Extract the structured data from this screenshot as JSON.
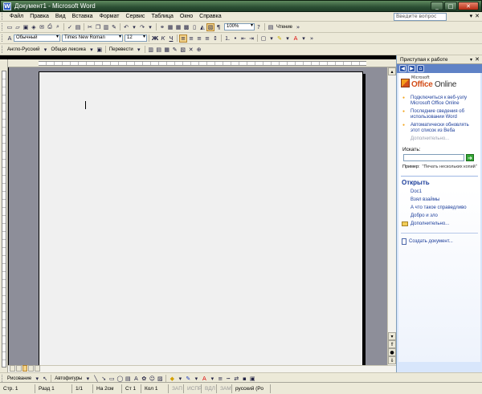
{
  "window": {
    "title": "Документ1 - Microsoft Word",
    "app_icon_letter": "W",
    "controls": {
      "minimize": "_",
      "maximize": "□",
      "close": "✕"
    }
  },
  "menu": {
    "items": [
      "Файл",
      "Правка",
      "Вид",
      "Вставка",
      "Формат",
      "Сервис",
      "Таблица",
      "Окно",
      "Справка"
    ],
    "help_placeholder": "Введите вопрос",
    "doc_controls": [
      "▾",
      "✕"
    ]
  },
  "standard_toolbar": {
    "zoom": "100%",
    "read_label": "Чтение"
  },
  "format_toolbar": {
    "style": "Обычный",
    "font": "Times New Roman",
    "size": "12"
  },
  "translate_toolbar": {
    "direction": "Англо-Русский",
    "vocabulary": "Общая лексика",
    "translate_label": "Перевести"
  },
  "task_pane": {
    "header": "Приступая к работе",
    "nav_icons": [
      "back-icon",
      "forward-icon",
      "home-icon"
    ],
    "logo": {
      "small": "Microsoft",
      "word1": "Office",
      "word2": "Online"
    },
    "links": [
      "Подключиться к веб-узлу Microsoft Office Online",
      "Последние сведения об использовании Word",
      "Автоматически обновлять этот список из Веба"
    ],
    "more_link": "Дополнительно...",
    "search_label": "Искать:",
    "example_label": "Пример:",
    "example_text": "\"Печать нескольких копий\"",
    "open_title": "Открыть",
    "files": [
      "Doc1",
      "Взял взаймы",
      "А что такое справедливо",
      "Добро и зло"
    ],
    "open_more": "Дополнительно...",
    "create_doc": "Создать документ..."
  },
  "drawing_toolbar": {
    "draw_label": "Рисование",
    "autoshapes_label": "Автофигуры"
  },
  "status": {
    "page": "Стр. 1",
    "section": "Разд 1",
    "pages": "1/1",
    "at": "На 2см",
    "line": "Ст 1",
    "column": "Кол 1",
    "rec": "ЗАП",
    "trk": "ИСПР",
    "ext": "ВДЛ",
    "ovr": "ЗАМ",
    "language": "русский (Ро"
  }
}
